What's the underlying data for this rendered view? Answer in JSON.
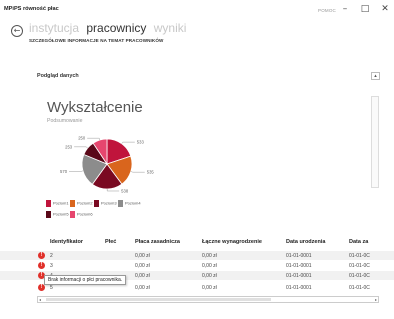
{
  "window": {
    "title": "MPiPS równość płac",
    "help": "POMOC",
    "minimize": "–",
    "maximize": "□",
    "close": "✕"
  },
  "nav": {
    "back_icon": "arrow-left-icon",
    "items": [
      {
        "label": "instytucja",
        "active": false
      },
      {
        "label": "pracownicy",
        "active": true
      },
      {
        "label": "wyniki",
        "active": false
      }
    ],
    "subtitle": "SZCZEGÓŁOWE INFORMACJE NA TEMAT PRACOWNIKÓW"
  },
  "section": {
    "title": "Podgląd danych",
    "collapse_icon": "▴"
  },
  "chart_data": {
    "type": "pie",
    "title": "Wykształcenie",
    "subtitle": "Podsumowanie",
    "slices": [
      {
        "name": "Poziom1",
        "value": 533,
        "color": "#c0143c"
      },
      {
        "name": "Poziom2",
        "value": 535,
        "color": "#d9651d"
      },
      {
        "name": "Poziom3",
        "value": 538,
        "color": "#7a0a22"
      },
      {
        "name": "Poziom4",
        "value": 570,
        "color": "#8c8c8c"
      },
      {
        "name": "Poziom5",
        "value": 253,
        "color": "#5a0818"
      },
      {
        "name": "Poziom6",
        "value": 250,
        "color": "#e6466e"
      }
    ],
    "data_labels": [
      "533",
      "535",
      "538",
      "570",
      "253",
      "250"
    ],
    "legend_position": "bottom-left"
  },
  "table": {
    "columns": [
      "Identyfikator",
      "Płeć",
      "Płaca zasadnicza",
      "Łączne wynagrodzenie",
      "Data urodzenia",
      "Data za"
    ],
    "rows": [
      {
        "id": "2",
        "sex": "",
        "base": "0,00 zł",
        "total": "0,00 zł",
        "birth": "01-01-0001",
        "hire": "01-01-0C"
      },
      {
        "id": "3",
        "sex": "",
        "base": "0,00 zł",
        "total": "0,00 zł",
        "birth": "01-01-0001",
        "hire": "01-01-0C"
      },
      {
        "id": "4",
        "sex": "",
        "base": "0,00 zł",
        "total": "0,00 zł",
        "birth": "01-01-0001",
        "hire": "01-01-0C"
      },
      {
        "id": "5",
        "sex": "",
        "base": "0,00 zł",
        "total": "0,00 zł",
        "birth": "01-01-0001",
        "hire": "01-01-0C"
      }
    ],
    "error_icon": "!",
    "tooltip": "Brak informacji o płci pracownika."
  },
  "scroll": {
    "left_arrow": "◂",
    "right_arrow": "▸"
  },
  "colors": {
    "accent": "#c0143c",
    "error": "#e0302a"
  }
}
